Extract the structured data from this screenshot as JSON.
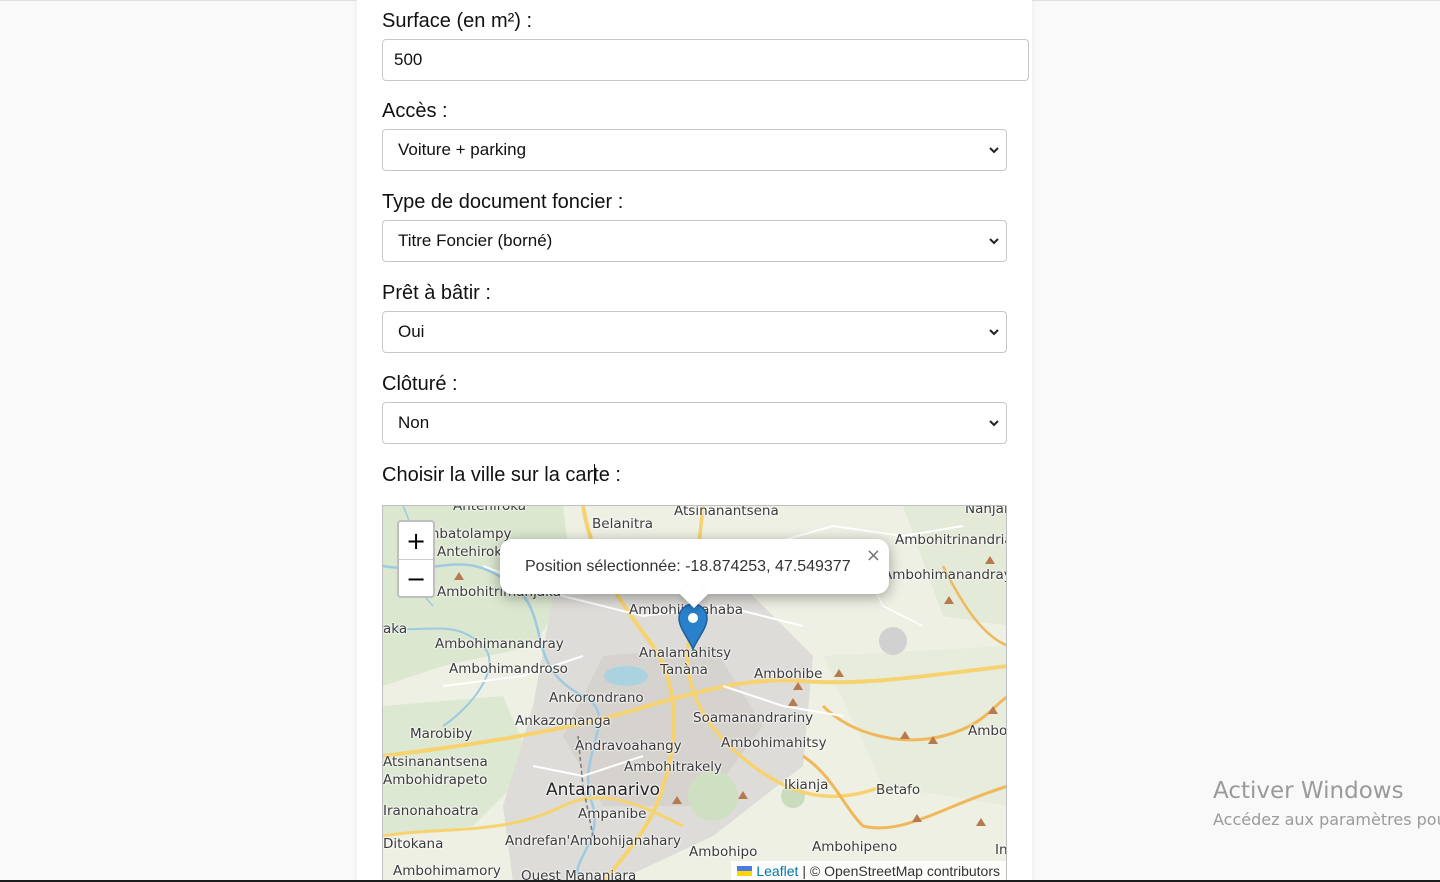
{
  "form": {
    "surface_label": "Surface (en m²) :",
    "surface_value": "500",
    "acces_label": "Accès :",
    "acces_value": "Voiture + parking",
    "document_label": "Type de document foncier :",
    "document_value": "Titre Foncier (borné)",
    "pret_label": "Prêt à bâtir :",
    "pret_value": "Oui",
    "cloture_label": "Clôturé :",
    "cloture_value": "Non",
    "map_label": "Choisir la ville sur la carte :"
  },
  "map": {
    "zoom_in": "+",
    "zoom_out": "−",
    "popup_text": "Position sélectionnée: -18.874253, 47.549377",
    "popup_close": "×",
    "attribution_link": "Leaflet",
    "attribution_text": "| © OpenStreetMap contributors",
    "places": [
      "Antehiroka",
      "Belanitra",
      "Atsinanantsena",
      "Nanjak",
      "Ambohitrinandrian",
      "Ambatolampy",
      "Antehiroka",
      "Ambohimanandray",
      "Ambohitrimanjaka",
      "Ambohijanahaba",
      "Analamahitsy",
      "Ambohimanandray",
      "Ambohimandroso",
      "Tanàna",
      "Ambohibe",
      "Ankorondrano",
      "Ankazomanga",
      "Soamanandrariny",
      "Marobiby",
      "Andravoahangy",
      "Ambohimahitsy",
      "Ambol",
      "Atsinanantsena",
      "Ambohidrapeto",
      "Ambohitrakely",
      "Ikianja",
      "Antananarivo",
      "Betafo",
      "Iranonahoatra",
      "Ampanibe",
      "Ditokana",
      "Andrefan'Ambohijanahary",
      "Ambohipeno",
      "Ambohipo",
      "Ambohimamory",
      "Ouest Mananjara",
      "In",
      "aka"
    ]
  },
  "watermark": {
    "title": "Activer Windows",
    "subtitle": "Accédez aux paramètres pou"
  }
}
